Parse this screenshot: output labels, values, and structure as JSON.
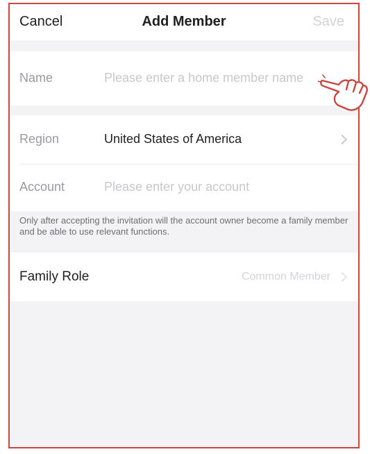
{
  "header": {
    "cancel_label": "Cancel",
    "title": "Add Member",
    "save_label": "Save"
  },
  "form": {
    "name": {
      "label": "Name",
      "placeholder": "Please enter a home member name"
    },
    "region": {
      "label": "Region",
      "value": "United States of America"
    },
    "account": {
      "label": "Account",
      "placeholder": "Please enter your account"
    }
  },
  "hint_text": "Only after accepting the invitation will the account owner become a family member and be able to use relevant functions.",
  "family_role": {
    "label": "Family Role",
    "value": "Common Member"
  },
  "colors": {
    "frame_border": "#c9453f",
    "background": "#f3f3f5",
    "placeholder": "#c8c8cc",
    "pointer_hand": "#c9453f"
  },
  "icons": [
    "chevron-right-icon",
    "pointing-hand-icon"
  ]
}
